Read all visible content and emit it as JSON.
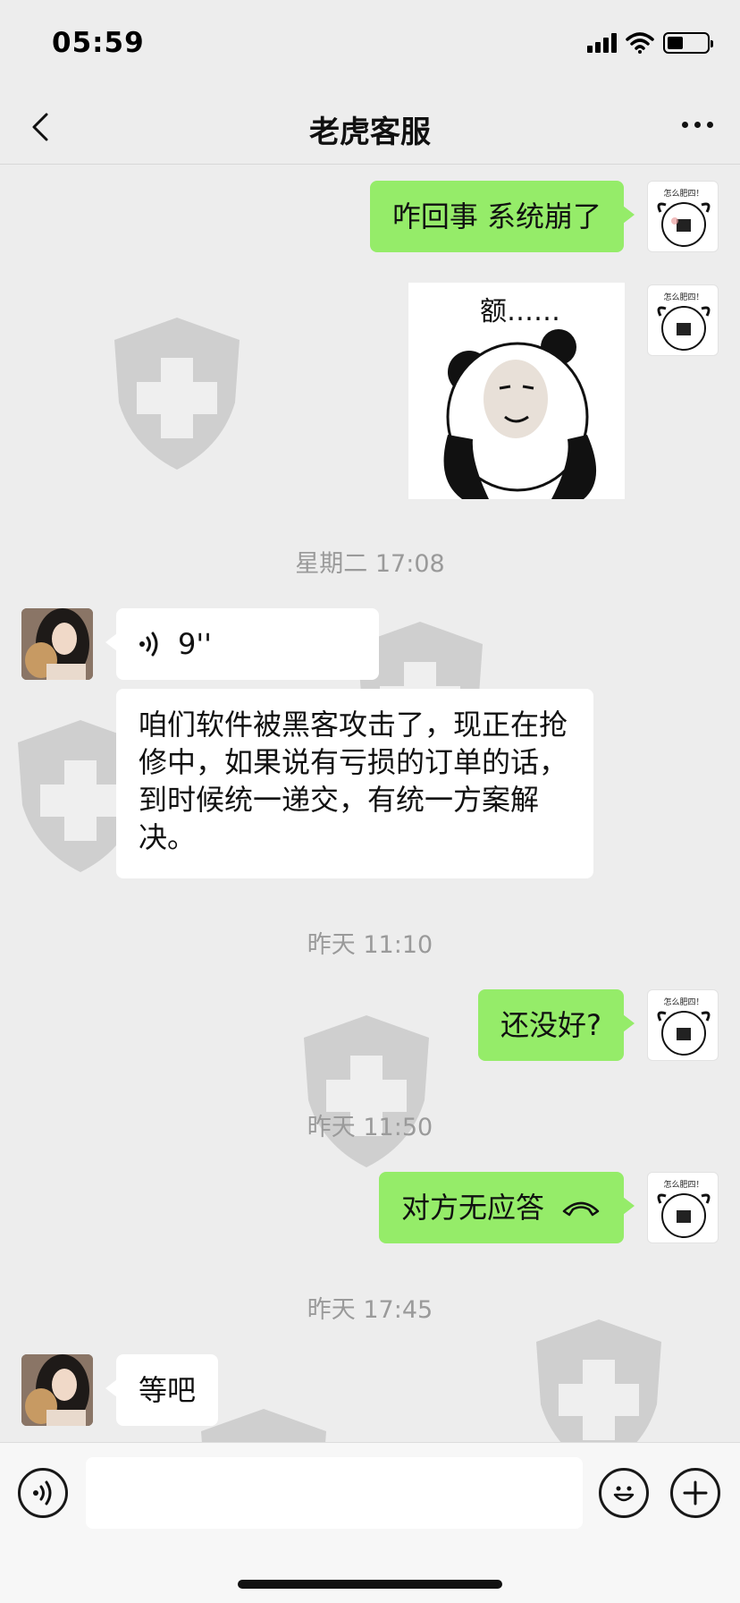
{
  "status_bar": {
    "time": "05:59"
  },
  "nav": {
    "title": "老虎客服"
  },
  "messages": {
    "m1": "咋回事 系统崩了",
    "sticker_caption": "额……",
    "ts1": "星期二 17:08",
    "voice_duration": "9''",
    "m3": "咱们软件被黑客攻击了，现正在抢修中，如果说有亏损的订单的话，到时候统一递交，有统一方案解决。",
    "ts2": "昨天 11:10",
    "m4": "还没好?",
    "ts3": "昨天 11:50",
    "call_text": "对方无应答",
    "ts4": "昨天 17:45",
    "m6": "等吧"
  },
  "avatar_sticker_text": "怎么肥四！",
  "colors": {
    "my_bubble": "#95ec69",
    "their_bubble": "#ffffff",
    "background": "#ededed"
  },
  "icons": [
    "back-icon",
    "more-icon",
    "voice-wave-icon",
    "hangup-phone-icon",
    "voice-input-icon",
    "emoji-icon",
    "plus-icon"
  ]
}
